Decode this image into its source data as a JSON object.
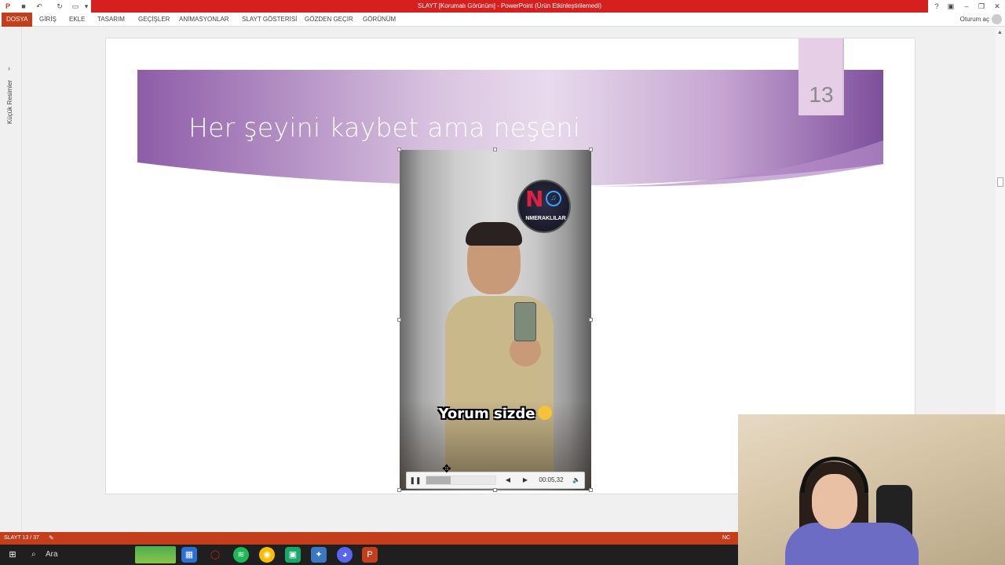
{
  "window": {
    "title": "SLAYT [Korumalı Görünüm] - PowerPoint (Ürün Etkinleştirilemedi)"
  },
  "ribbon": {
    "tabs": [
      "DOSYA",
      "GİRİŞ",
      "EKLE",
      "TASARIM",
      "GEÇİŞLER",
      "ANİMASYONLAR",
      "SLAYT GÖSTERİSİ",
      "GÖZDEN GEÇİR",
      "GÖRÜNÜM"
    ],
    "signin": "Oturum aç"
  },
  "left_pane": {
    "label": "Küçük Resimler"
  },
  "slide": {
    "title": "Her şeyini kaybet ama neşeni",
    "number": "13",
    "video": {
      "logo_text": "NMERAKLILAR",
      "logo_letter": "N",
      "caption": "Yorum sizde",
      "time": "00:05,32",
      "progress": 0.35
    }
  },
  "statusbar": {
    "slide_indicator": "SLAYT 13 / 37",
    "notes": "NC"
  },
  "taskbar": {
    "search_placeholder": "Ara"
  },
  "colors": {
    "accent": "#c43e1c",
    "titlebar": "#d62020",
    "banner_purple": "#8e5ca8"
  }
}
